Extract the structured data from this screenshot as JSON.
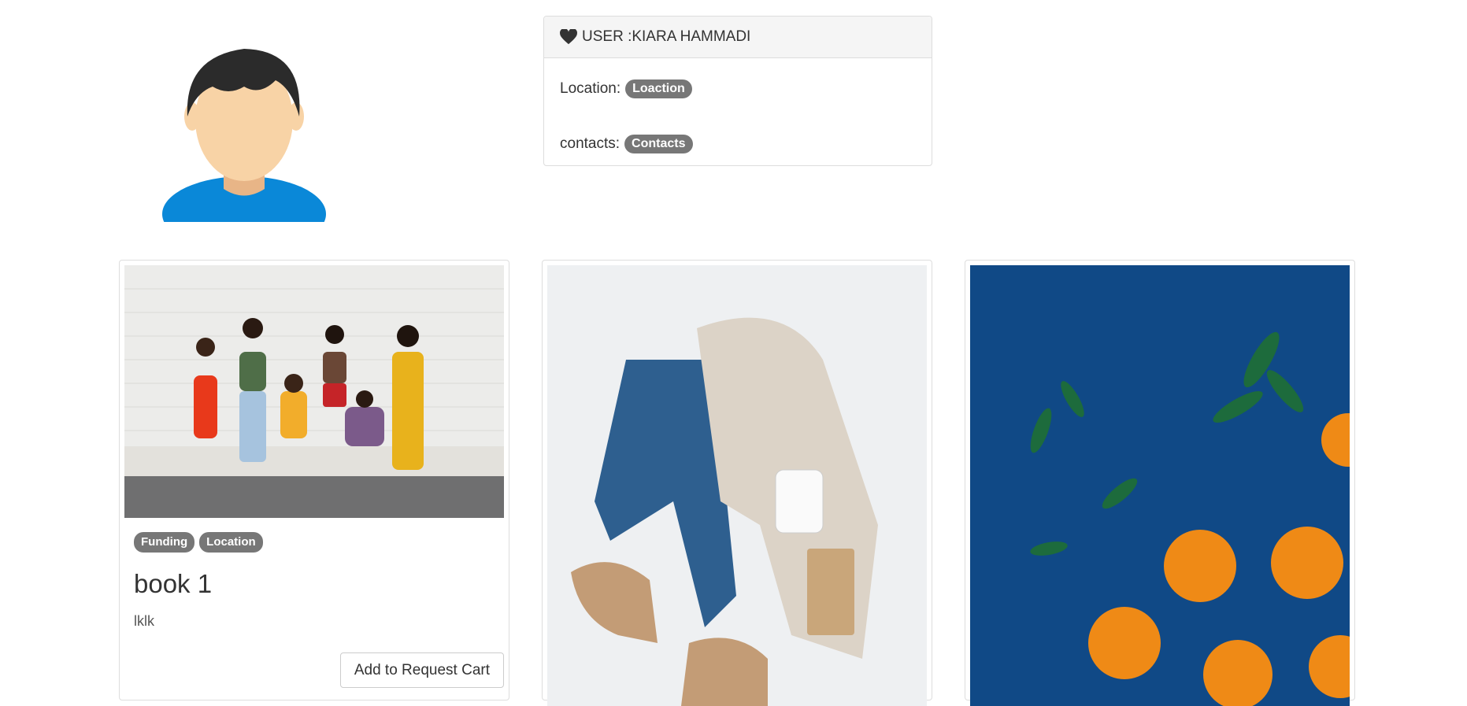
{
  "user_panel": {
    "heading": "USER :KIARA HAMMADI",
    "location_label": "Location:",
    "location_badge": "Loaction",
    "contacts_label": "contacts:",
    "contacts_badge": "Contacts"
  },
  "cards": [
    {
      "image": "group-of-women-photo",
      "tags": [
        "Funding",
        "Location"
      ],
      "title": "book 1",
      "description": "lklk",
      "button_label": "Add to Request Cart"
    },
    {
      "image": "clothing-flatlay-photo"
    },
    {
      "image": "oranges-on-blue-photo"
    }
  ],
  "colors": {
    "badge": "#777777",
    "panel_header": "#f5f5f5",
    "border": "#dddddd",
    "avatar_shirt": "#0a88d8",
    "avatar_hair": "#2b2b2b",
    "avatar_skin": "#f8d3a6"
  }
}
